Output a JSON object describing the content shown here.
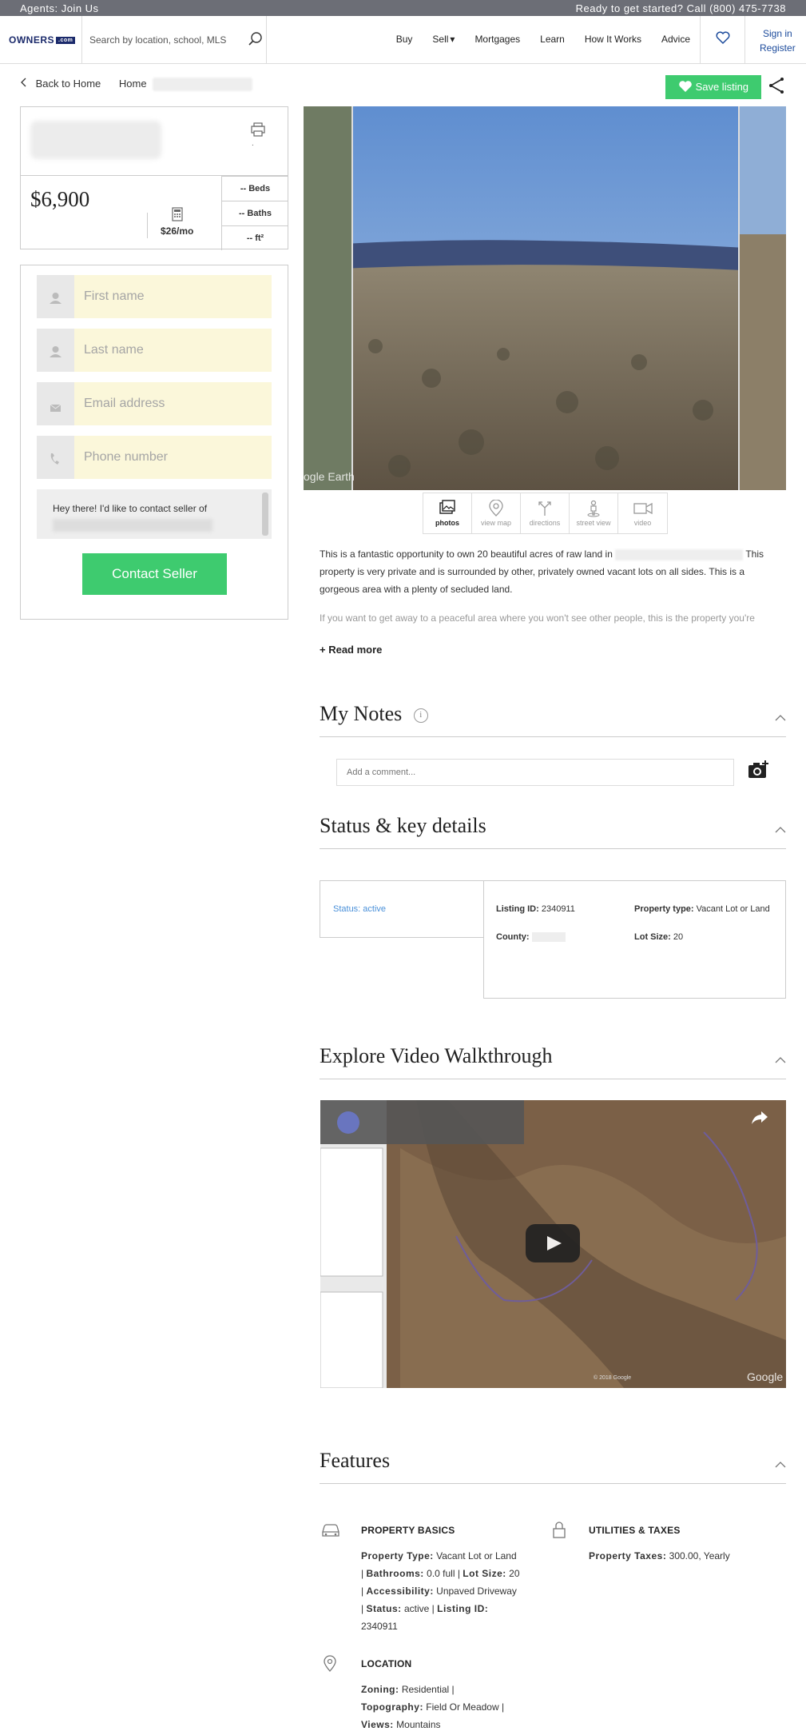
{
  "topbar": {
    "left": "Agents: Join Us",
    "right": "Ready to get started? Call (800) 475-7738"
  },
  "nav": {
    "logo": "OWNERS",
    "logo_suffix": ".com",
    "search_placeholder": "Search by location, school, MLS",
    "links": [
      "Buy",
      "Sell",
      "Mortgages",
      "Learn",
      "How It Works",
      "Advice"
    ],
    "sell_caret": "▾",
    "sign_in": "Sign in",
    "register": "Register"
  },
  "breadcrumb": {
    "back": "Back to Home",
    "home": "Home"
  },
  "save_listing": "Save listing",
  "summary": {
    "price": "$6,900",
    "monthly": "$26/mo",
    "beds": "-- Beds",
    "baths": "-- Baths",
    "sqft": "-- ft²",
    "dot": "."
  },
  "form": {
    "first_name": "First name",
    "last_name": "Last name",
    "email": "Email address",
    "phone": "Phone number",
    "message": "Hey there! I'd like to contact seller of",
    "contact_button": "Contact Seller"
  },
  "gallery": {
    "watermark": "ogle Earth"
  },
  "media_tabs": [
    {
      "label": "photos",
      "icon": "photos-icon"
    },
    {
      "label": "view map",
      "icon": "map-pin-icon"
    },
    {
      "label": "directions",
      "icon": "directions-icon"
    },
    {
      "label": "street view",
      "icon": "street-view-icon"
    },
    {
      "label": "video",
      "icon": "video-icon"
    }
  ],
  "description": {
    "p1_a": "This is a fantastic opportunity to own 20 beautiful acres of raw land in",
    "p1_b": "This property is very private and is surrounded by other, privately owned vacant lots on all sides. This is a gorgeous area with a plenty of secluded land.",
    "p2": "If you want to get away to a peaceful area where you won't see other people, this is the property you're",
    "read_more": "+ Read more"
  },
  "notes": {
    "title": "My Notes",
    "info": "i",
    "placeholder": "Add a comment..."
  },
  "status_section": {
    "title": "Status & key details",
    "status": "Status: active",
    "listing_id_label": "Listing ID:",
    "listing_id": "2340911",
    "county_label": "County:",
    "property_type_label": "Property type:",
    "property_type": "Vacant Lot or Land",
    "lot_size_label": "Lot Size:",
    "lot_size": "20"
  },
  "video_section": {
    "title": "Explore Video Walkthrough",
    "watermark": "Google",
    "copyright": "© 2018 Google"
  },
  "features": {
    "title": "Features",
    "basics_title": "PROPERTY BASICS",
    "basics": [
      {
        "k": "Property Type:",
        "v": "Vacant Lot or Land"
      },
      {
        "k": "Bathrooms:",
        "v": "0.0 full"
      },
      {
        "k": "Lot Size:",
        "v": "20"
      },
      {
        "k": "Accessibility:",
        "v": "Unpaved Driveway"
      },
      {
        "k": "Status:",
        "v": "active"
      },
      {
        "k": "Listing ID:",
        "v": "2340911"
      }
    ],
    "utilities_title": "UTILITIES & TAXES",
    "taxes_label": "Property Taxes:",
    "taxes": "300.00, Yearly",
    "location_title": "LOCATION",
    "zoning_label": "Zoning:",
    "zoning": "Residential |",
    "topography_label": "Topography:",
    "topography": "Field Or Meadow |",
    "views_label": "Views:",
    "views": "Mountains"
  },
  "colors": {
    "accent_green": "#3ecb6f",
    "brand_navy": "#1b2a6b",
    "link_blue": "#1b4a9b",
    "topbar": "#6c6e76",
    "field_bg": "#fbf7da"
  }
}
